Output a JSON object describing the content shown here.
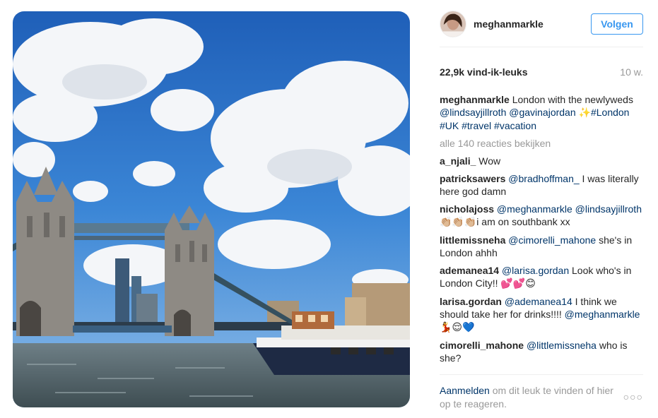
{
  "post": {
    "username": "meghanmarkle",
    "follow_label": "Volgen",
    "likes": "22,9k vind-ik-leuks",
    "time": "10 w."
  },
  "caption": {
    "user": "meghanmarkle",
    "text": "London with the newlyweds",
    "mention1": "@lindsayjillroth",
    "mention2": "@gavinajordan",
    "sparkle": "✨",
    "tags": [
      "#London",
      "#UK",
      "#travel",
      "#vacation"
    ]
  },
  "view_all": "alle 140 reacties bekijken",
  "comments": [
    {
      "user": "a_njali_",
      "mentions": [],
      "text": "Wow"
    },
    {
      "user": "patricksawers",
      "mentions": [
        "@bradhoffman_"
      ],
      "text": "I was literally here god damn"
    },
    {
      "user": "nicholajoss",
      "mentions": [
        "@meghanmarkle",
        "@lindsayjillroth"
      ],
      "emoji": "👏🏼👏🏼👏🏼",
      "text": "i am on southbank xx"
    },
    {
      "user": "littlemissneha",
      "mentions": [
        "@cimorelli_mahone"
      ],
      "text": "she's in London ahhh"
    },
    {
      "user": "ademanea14",
      "mentions": [
        "@larisa.gordan"
      ],
      "text": "Look who's in London City!!",
      "emoji": "💕💕😊"
    },
    {
      "user": "larisa.gordan",
      "mentions": [
        "@ademanea14"
      ],
      "text": "I think we should take her for drinks!!!!",
      "mention_after": "@meghanmarkle",
      "emoji": "💃😌💙"
    },
    {
      "user": "cimorelli_mahone",
      "mentions": [
        "@littlemissneha"
      ],
      "text": "who is she?"
    }
  ],
  "footer": {
    "login_link": "Aanmelden",
    "login_text": "om dit leuk te vinden of hier op te reageren.",
    "more": "○○○"
  },
  "icons": {
    "more": "more-options-icon",
    "avatar": "profile-avatar"
  },
  "colors": {
    "link": "#003569",
    "button": "#3897f0",
    "muted": "#999999",
    "text": "#262626"
  }
}
